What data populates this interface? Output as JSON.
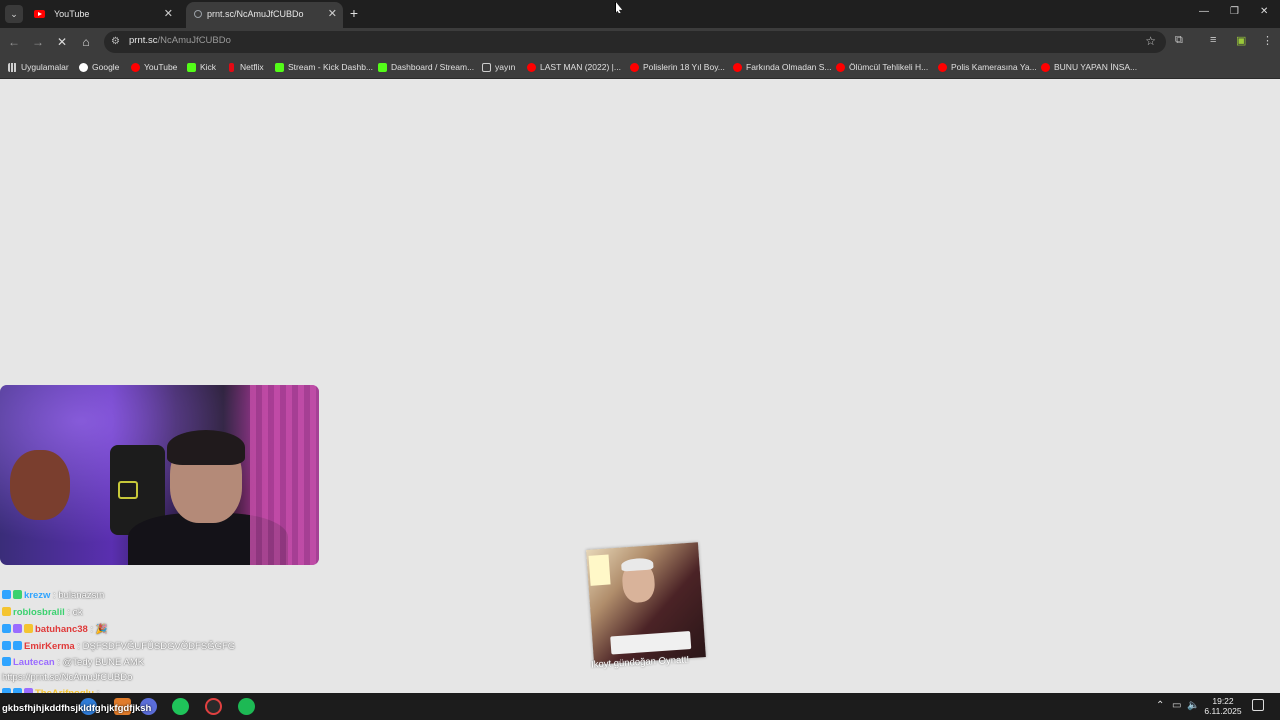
{
  "browser": {
    "tabs": [
      {
        "title": "YouTube",
        "active": false
      },
      {
        "title": "prnt.sc/NcAmuJfCUBDo",
        "active": true
      }
    ],
    "address": {
      "host": "prnt.sc",
      "path": "/NcAmuJfCUBDo"
    },
    "bookmarks": [
      {
        "label": "Uygulamalar",
        "icon": "apps-grid-icon"
      },
      {
        "label": "Google",
        "icon": "google-icon"
      },
      {
        "label": "YouTube",
        "icon": "youtube-icon"
      },
      {
        "label": "Kick",
        "icon": "kick-icon"
      },
      {
        "label": "Netflix",
        "icon": "netflix-icon"
      },
      {
        "label": "Stream - Kick Dashb...",
        "icon": "kick-icon"
      },
      {
        "label": "Dashboard / Stream...",
        "icon": "dashboard-icon"
      },
      {
        "label": "yayın",
        "icon": "folder-icon"
      },
      {
        "label": "LAST MAN (2022) |...",
        "icon": "youtube-icon"
      },
      {
        "label": "Polislerin 18 Yıl Boy...",
        "icon": "youtube-icon"
      },
      {
        "label": "Farkında Olmadan S...",
        "icon": "youtube-icon"
      },
      {
        "label": "Ölümcül Tehlikeli H...",
        "icon": "youtube-icon"
      },
      {
        "label": "Polis Kamerasına Ya...",
        "icon": "youtube-icon"
      },
      {
        "label": "BUNU YAPAN İNSA...",
        "icon": "youtube-icon"
      }
    ]
  },
  "overlay": {
    "chat": [
      {
        "user": "krezw",
        "message": ": bulanazsın",
        "color": "#2fa4ff",
        "badges": [
          "b-blue",
          "b-green"
        ]
      },
      {
        "user": "roblosbralil",
        "message": ": ok",
        "color": "#3bd16f",
        "badges": [
          "b-yellow"
        ]
      },
      {
        "user": "batuhanc38",
        "message": ": 🎉",
        "color": "#e03a3a",
        "badges": [
          "b-blue",
          "b-purple",
          "b-yellow"
        ]
      },
      {
        "user": "EmirKerma",
        "message": ": DŞFSDFVĞUFÜSDGVÖDFSĞGFG",
        "color": "#e03a3a",
        "badges": [
          "b-blue",
          "b-blue"
        ]
      },
      {
        "user": "Lautecan",
        "message": ": @Tedy BUNE AMK",
        "color": "#9a6cff",
        "badges": [
          "b-blue"
        ]
      },
      {
        "user": "",
        "message": "https://prnt.sc/NcAmuJfCUBDo",
        "color": "#ffffff",
        "badges": []
      },
      {
        "user": "TheArifnoglu",
        "message": ":",
        "color": "#f4c430",
        "badges": [
          "b-blue",
          "b-blue",
          "b-purple"
        ]
      }
    ],
    "sticker_caption": "Ikoyt gündoğan Oynatt!"
  },
  "taskbar": {
    "typing_text": "gkbsfhjhjkddfhsjkldfghjkfgdfjksh",
    "clock_time": "19:22",
    "clock_date": "6.11.2025"
  }
}
